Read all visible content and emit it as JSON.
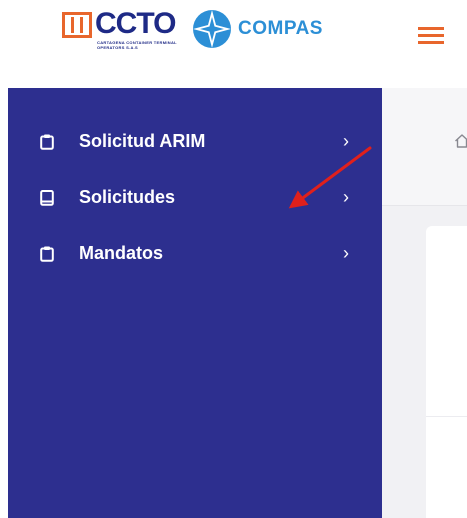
{
  "header": {
    "ccto_logo_text": "CCTO",
    "ccto_logo_subtext": "CARTAGENA CONTAINER TERMINAL OPERATORS S.A.S",
    "compas_logo_text": "COMPAS"
  },
  "sidebar": {
    "items": [
      {
        "label": "Solicitud ARIM",
        "icon": "clipboard-icon",
        "chevron": "›"
      },
      {
        "label": "Solicitudes",
        "icon": "book-icon",
        "chevron": "›"
      },
      {
        "label": "Mandatos",
        "icon": "clipboard-icon",
        "chevron": "›"
      }
    ]
  },
  "colors": {
    "sidebar_bg": "#2d2f8f",
    "brand_orange": "#e8662c",
    "brand_navy": "#1e2a86",
    "brand_blue": "#2c8fd6",
    "annotation_red": "#e0201c"
  }
}
